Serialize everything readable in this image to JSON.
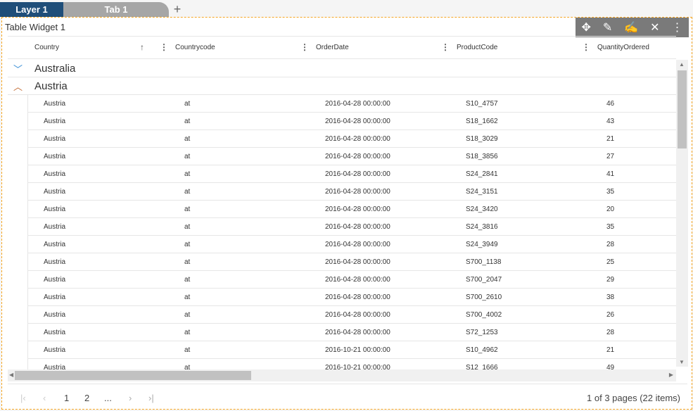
{
  "tabs": {
    "layer": "Layer 1",
    "tab": "Tab 1",
    "add": "+"
  },
  "widget": {
    "title": "Table Widget 1",
    "toolbar": [
      {
        "icon": "move-icon",
        "glyph": "✥"
      },
      {
        "icon": "design-icon",
        "glyph": "✎"
      },
      {
        "icon": "edit-icon",
        "glyph": "✍"
      },
      {
        "icon": "settings-tools-icon",
        "glyph": "✕"
      },
      {
        "icon": "more-vertical-icon",
        "glyph": "⋮"
      }
    ]
  },
  "columns": [
    "Country",
    "Countrycode",
    "OrderDate",
    "ProductCode",
    "QuantityOrdered"
  ],
  "sort_glyph": "↑",
  "groups": [
    {
      "label": "Australia",
      "expanded": false
    },
    {
      "label": "Austria",
      "expanded": true
    }
  ],
  "rows": [
    [
      "Austria",
      "at",
      "2016-04-28 00:00:00",
      "S10_4757",
      "46"
    ],
    [
      "Austria",
      "at",
      "2016-04-28 00:00:00",
      "S18_1662",
      "43"
    ],
    [
      "Austria",
      "at",
      "2016-04-28 00:00:00",
      "S18_3029",
      "21"
    ],
    [
      "Austria",
      "at",
      "2016-04-28 00:00:00",
      "S18_3856",
      "27"
    ],
    [
      "Austria",
      "at",
      "2016-04-28 00:00:00",
      "S24_2841",
      "41"
    ],
    [
      "Austria",
      "at",
      "2016-04-28 00:00:00",
      "S24_3151",
      "35"
    ],
    [
      "Austria",
      "at",
      "2016-04-28 00:00:00",
      "S24_3420",
      "20"
    ],
    [
      "Austria",
      "at",
      "2016-04-28 00:00:00",
      "S24_3816",
      "35"
    ],
    [
      "Austria",
      "at",
      "2016-04-28 00:00:00",
      "S24_3949",
      "28"
    ],
    [
      "Austria",
      "at",
      "2016-04-28 00:00:00",
      "S700_1138",
      "25"
    ],
    [
      "Austria",
      "at",
      "2016-04-28 00:00:00",
      "S700_2047",
      "29"
    ],
    [
      "Austria",
      "at",
      "2016-04-28 00:00:00",
      "S700_2610",
      "38"
    ],
    [
      "Austria",
      "at",
      "2016-04-28 00:00:00",
      "S700_4002",
      "26"
    ],
    [
      "Austria",
      "at",
      "2016-04-28 00:00:00",
      "S72_1253",
      "28"
    ],
    [
      "Austria",
      "at",
      "2016-10-21 00:00:00",
      "S10_4962",
      "21"
    ],
    [
      "Austria",
      "at",
      "2016-10-21 00:00:00",
      "S12_1666",
      "49"
    ]
  ],
  "pager": {
    "first": "K",
    "prev": "‹",
    "pages": [
      "1",
      "2",
      "..."
    ],
    "next": "›",
    "last": "›|",
    "info": "1 of 3 pages (22 items)"
  }
}
